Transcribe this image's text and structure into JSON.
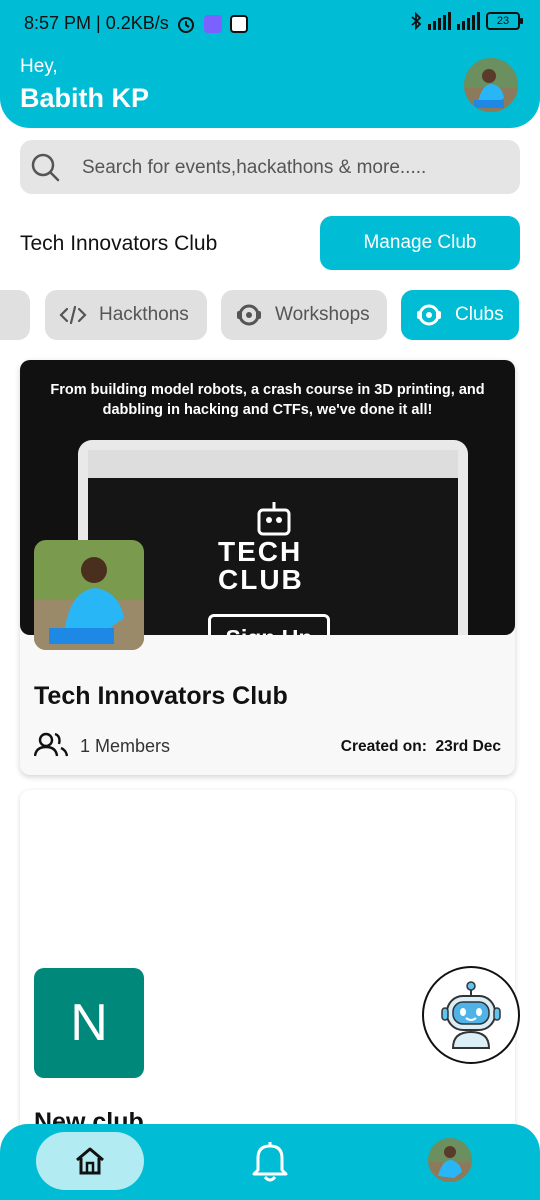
{
  "status_bar": {
    "time": "8:57 PM | 0.2KB/s",
    "battery": "23"
  },
  "header": {
    "greeting": "Hey,",
    "user_name": "Babith KP"
  },
  "search": {
    "placeholder": "Search for events,hackathons & more....."
  },
  "club_header": {
    "title": "Tech Innovators Club",
    "manage_label": "Manage Club"
  },
  "chips": [
    {
      "label": "Hackthons",
      "icon": "code-icon",
      "active": false
    },
    {
      "label": "Workshops",
      "icon": "workshop-icon",
      "active": false
    },
    {
      "label": "Clubs",
      "icon": "clubs-icon",
      "active": true
    }
  ],
  "clubs": [
    {
      "name": "Tech Innovators Club",
      "members": "1 Members",
      "created_label": "Created on:",
      "created_date": "23rd Dec",
      "banner": {
        "text": "From building model robots, a crash course in 3D printing, and dabbling in hacking and CTFs, we've done it all!",
        "title_line1": "TECH",
        "title_line2": "CLUB",
        "signup": "Sign Up"
      }
    },
    {
      "name": "New club",
      "initial": "N"
    }
  ],
  "colors": {
    "accent": "#00BCD4",
    "chip_inactive": "#E0E0E0",
    "club_n": "#00897B"
  }
}
